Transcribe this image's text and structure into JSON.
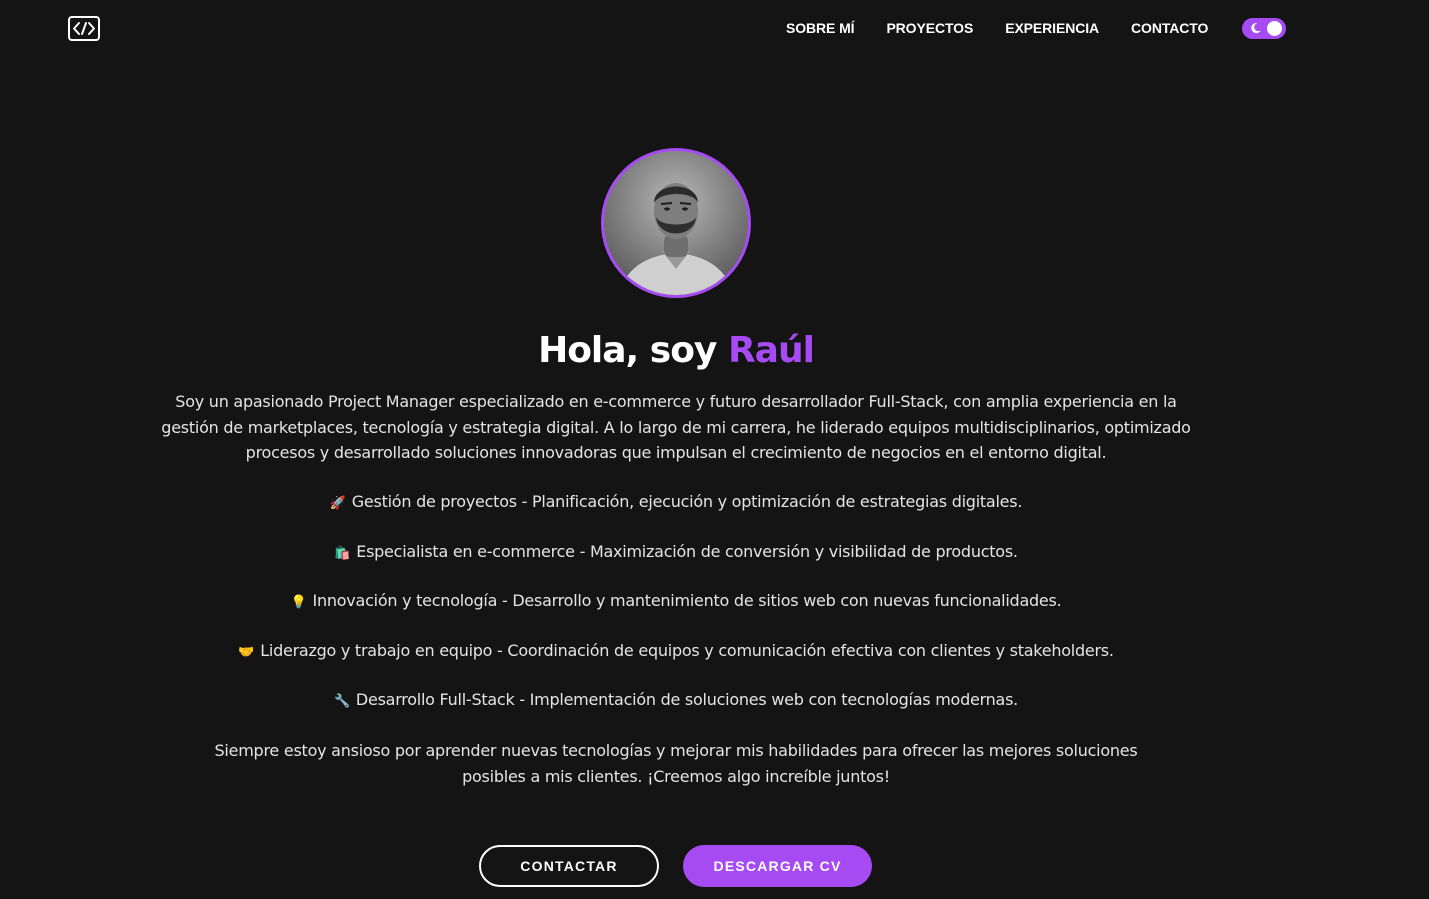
{
  "header": {
    "logo_icon": "code-brackets-icon",
    "nav": [
      {
        "label": "SOBRE MÍ"
      },
      {
        "label": "PROYECTOS"
      },
      {
        "label": "EXPERIENCIA"
      },
      {
        "label": "CONTACTO"
      }
    ],
    "theme_toggle": {
      "icon": "moon-icon",
      "state": "dark"
    }
  },
  "hero": {
    "title_prefix": "Hola, soy",
    "title_name": "Raúl",
    "intro": "Soy un apasionado Project Manager especializado en e-commerce y futuro desarrollador Full-Stack, con amplia experiencia en la gestión de marketplaces, tecnología y estrategia digital. A lo largo de mi carrera, he liderado equipos multidisciplinarios, optimizado procesos y desarrollado soluciones innovadoras que impulsan el crecimiento de negocios en el entorno digital.",
    "skills": [
      {
        "emoji": "🚀",
        "icon": "rocket-icon",
        "text": "Gestión de proyectos - Planificación, ejecución y optimización de estrategias digitales."
      },
      {
        "emoji": "🛍️",
        "icon": "shopping-bags-icon",
        "text": "Especialista en e-commerce - Maximización de conversión y visibilidad de productos."
      },
      {
        "emoji": "💡",
        "icon": "lightbulb-icon",
        "text": "Innovación y tecnología - Desarrollo y mantenimiento de sitios web con nuevas funcionalidades."
      },
      {
        "emoji": "🤝",
        "icon": "handshake-icon",
        "text": "Liderazgo y trabajo en equipo - Coordinación de equipos y comunicación efectiva con clientes y stakeholders."
      },
      {
        "emoji": "🔧",
        "icon": "wrench-icon",
        "text": "Desarrollo Full-Stack - Implementación de soluciones web con tecnologías modernas."
      }
    ],
    "closing": "Siempre estoy ansioso por aprender nuevas tecnologías y mejorar mis habilidades para ofrecer las mejores soluciones posibles a mis clientes. ¡Creemos algo increíble juntos!",
    "buttons": {
      "contact": "CONTACTAR",
      "download_cv": "DESCARGAR CV"
    }
  },
  "colors": {
    "background": "#141414",
    "accent": "#a64bf4",
    "text": "#ffffff",
    "body_text": "#e4e4e4"
  }
}
